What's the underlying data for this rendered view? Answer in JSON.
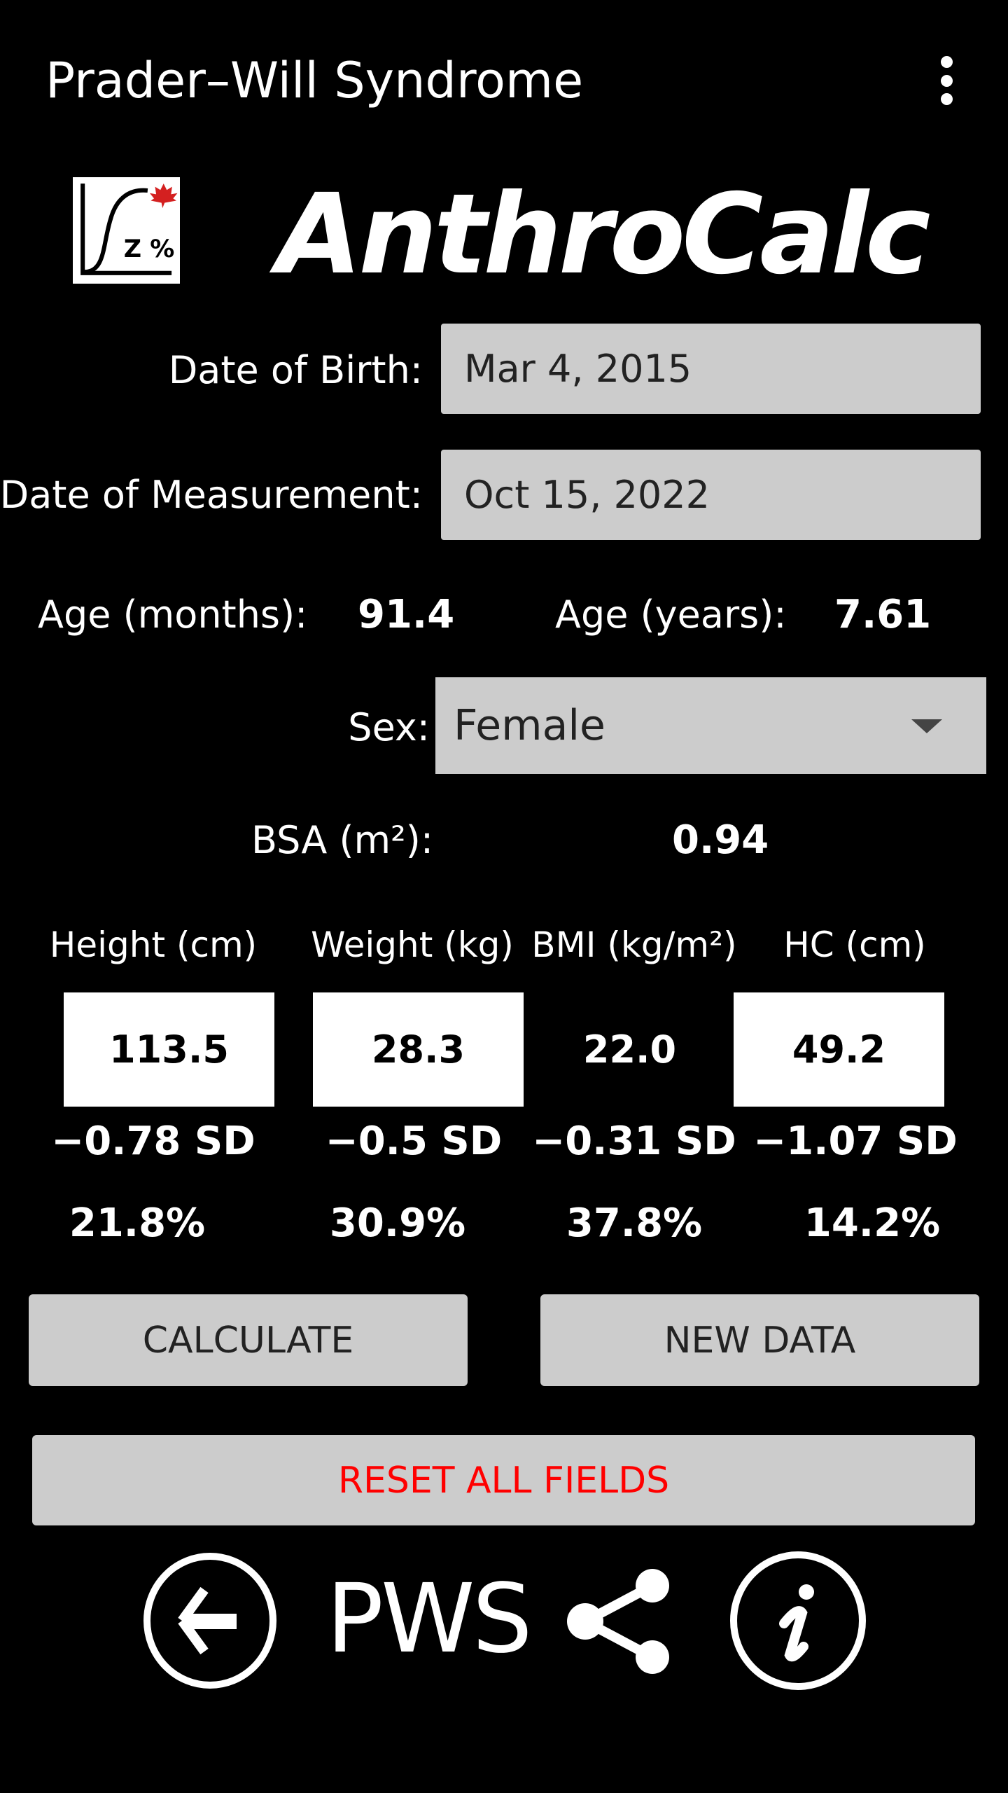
{
  "app_bar": {
    "title": "Prader–Will Syndrome",
    "menu_icon": "more-vert-icon"
  },
  "logo": {
    "text": "Z %",
    "icon": "growth-curve-maple-leaf-logo",
    "leaf_color": "#d42020"
  },
  "brand": "AnthroCalc",
  "dob": {
    "label": "Date of Birth:",
    "value": "Mar 4, 2015"
  },
  "dom": {
    "label": "Date of Measurement:",
    "value": "Oct 15, 2022"
  },
  "age": {
    "months_label": "Age (months):",
    "months": "91.4",
    "years_label": "Age (years):",
    "years": "7.61"
  },
  "sex": {
    "label": "Sex:",
    "value": "Female"
  },
  "bsa": {
    "label": "BSA (m²):",
    "value": "0.94"
  },
  "measures": [
    {
      "header": "Height (cm)",
      "value": "113.5",
      "sd": "−0.78 SD",
      "pct": "21.8%"
    },
    {
      "header": "Weight (kg)",
      "value": "28.3",
      "sd": "−0.5 SD",
      "pct": "30.9%"
    },
    {
      "header": "BMI (kg/m²)",
      "value": "22.0",
      "sd": "−0.31 SD",
      "pct": "37.8%"
    },
    {
      "header": "HC (cm)",
      "value": "49.2",
      "sd": "−1.07 SD",
      "pct": "14.2%"
    }
  ],
  "buttons": {
    "calculate": "CALCULATE",
    "new_data": "NEW DATA",
    "reset": "RESET ALL FIELDS",
    "reset_color": "#ff0000"
  },
  "bottom": {
    "pws": "PWS"
  }
}
